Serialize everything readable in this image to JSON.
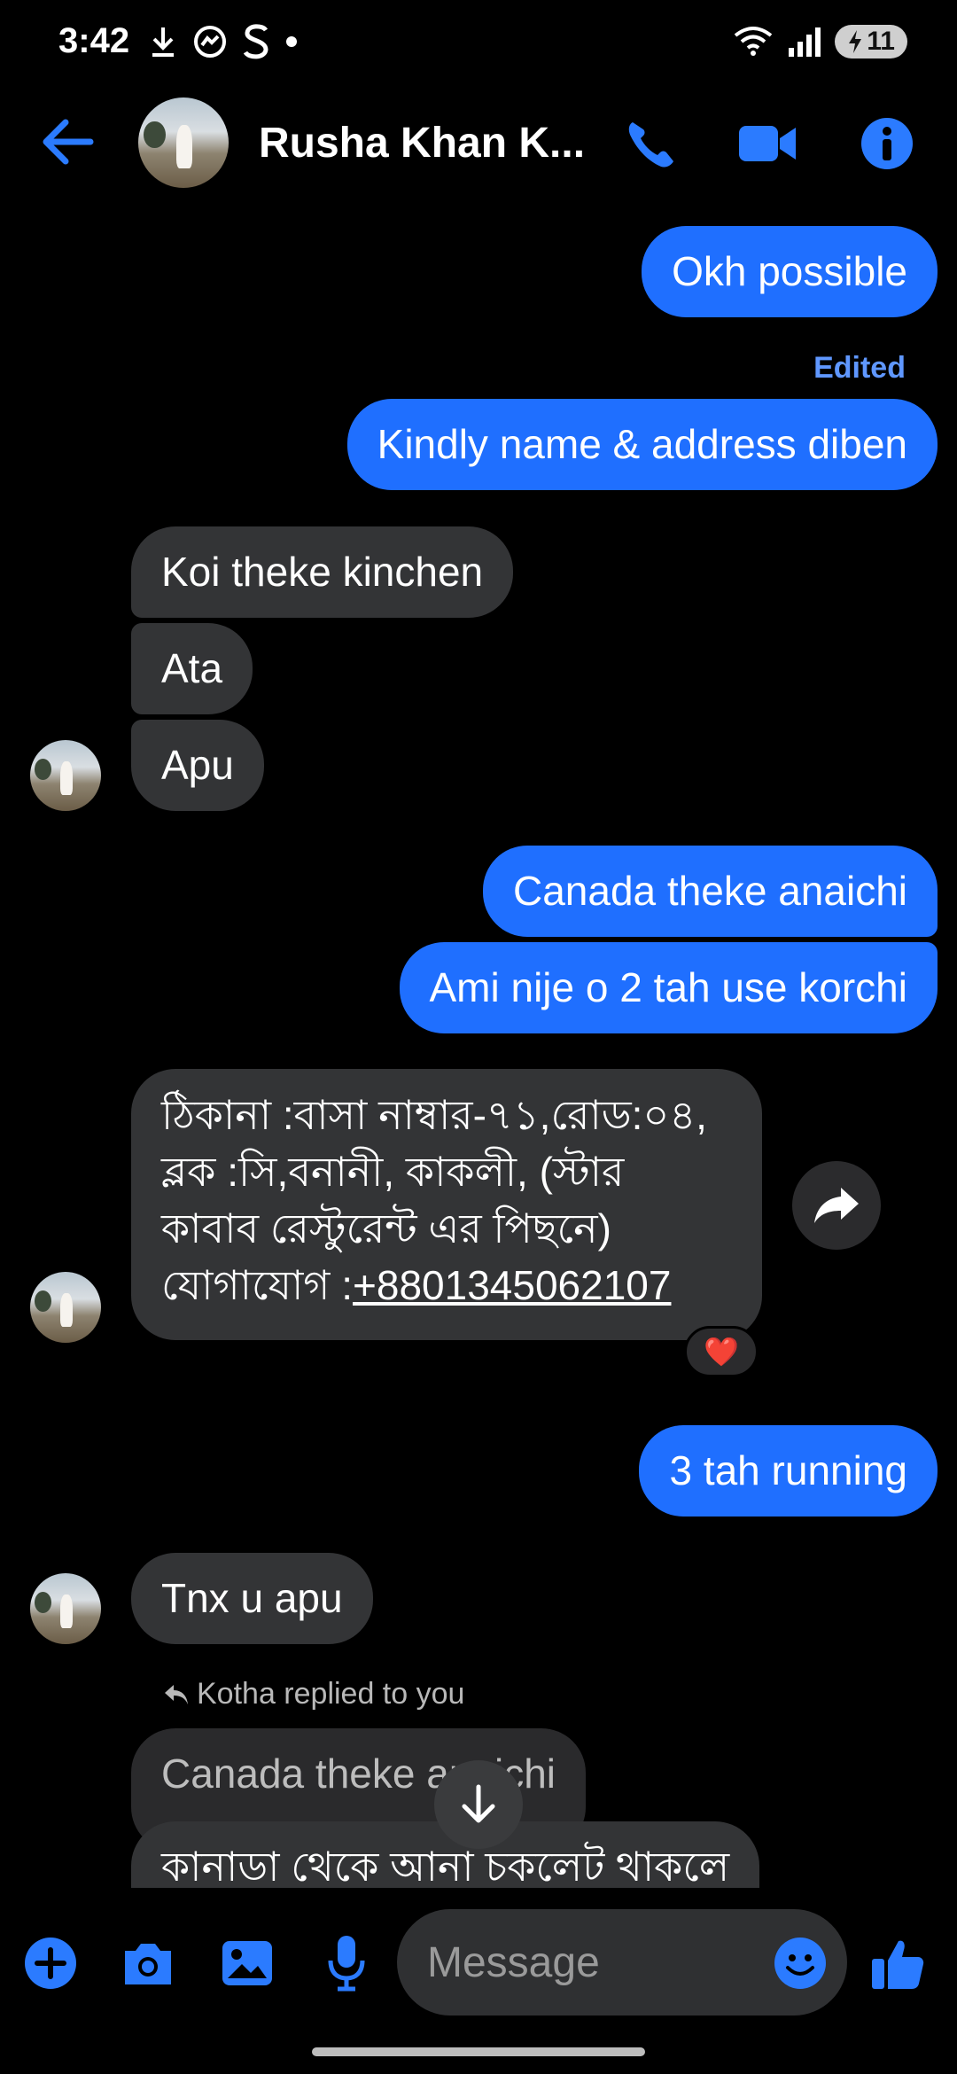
{
  "status_bar": {
    "time": "3:42",
    "battery_level": "11",
    "icons_left": [
      "download-icon",
      "messenger-icon",
      "s-app-icon",
      "dot-icon"
    ],
    "icons_right": [
      "wifi-icon",
      "signal-icon",
      "battery-charging-icon"
    ]
  },
  "header": {
    "contact_name": "Rusha Khan K...",
    "icons": [
      "back-arrow-icon",
      "phone-icon",
      "video-camera-icon",
      "info-icon"
    ]
  },
  "colors": {
    "accent": "#1f6fff",
    "incoming_bubble": "#333436",
    "background": "#000000",
    "edited_label": "#5f97ff",
    "heart": "#e8222c"
  },
  "messages": [
    {
      "id": "m1",
      "direction": "outgoing",
      "text": "Okh possible"
    },
    {
      "id": "m2",
      "direction": "outgoing",
      "text": "Kindly name & address diben",
      "edited_label": "Edited"
    },
    {
      "id": "m3",
      "direction": "incoming",
      "text": "Koi theke kinchen"
    },
    {
      "id": "m4",
      "direction": "incoming",
      "text": "Ata"
    },
    {
      "id": "m5",
      "direction": "incoming",
      "text": "Apu"
    },
    {
      "id": "m6",
      "direction": "outgoing",
      "text": "Canada theke anaichi"
    },
    {
      "id": "m7",
      "direction": "outgoing",
      "text": "Ami nije o 2 tah use korchi"
    },
    {
      "id": "m8",
      "direction": "incoming",
      "lines": [
        "ঠিকানা :বাসা নাম্বার-৭১,রোড:০৪,",
        "ব্লক :সি,বনানী, কাকলী, (স্টার",
        "কাবাব রেস্টুরেন্ট এর পিছনে)"
      ],
      "contact_prefix": "যোগাযোগ :",
      "phone": "+8801345062107",
      "reaction": "❤️"
    },
    {
      "id": "m9",
      "direction": "outgoing",
      "text": "3 tah running"
    },
    {
      "id": "m10",
      "direction": "incoming",
      "text": "Tnx u apu"
    },
    {
      "id": "m11",
      "direction": "incoming",
      "reply_label": "Kotha replied to you",
      "quoted_text": "Canada theke anaichi",
      "text": "কানাডা থেকে আনা চকলেট থাকলে"
    }
  ],
  "composer": {
    "placeholder": "Message",
    "icons": [
      "plus-icon",
      "camera-icon",
      "gallery-icon",
      "microphone-icon",
      "emoji-icon",
      "thumbs-up-icon"
    ]
  },
  "scroll_down_icon": "arrow-down-icon"
}
